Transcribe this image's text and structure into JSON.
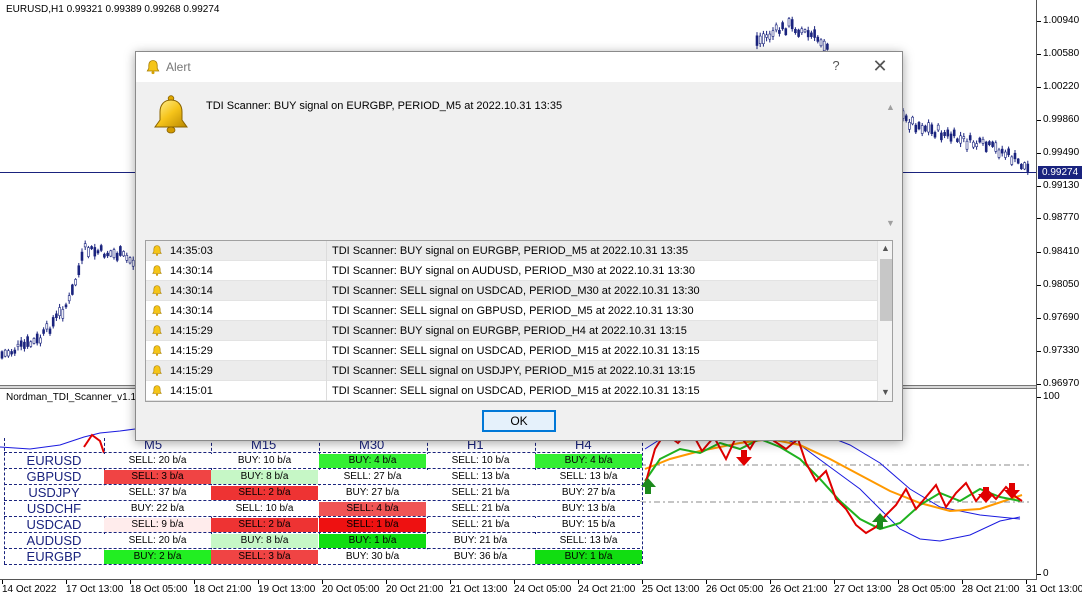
{
  "chart": {
    "symbol_line": "EURUSD,H1  0.99321 0.99389 0.99268 0.99274",
    "indicator_name": "Nordman_TDI_Scanner_v1.1",
    "current_price": "0.99274",
    "price_axis": [
      "1.00940",
      "1.00580",
      "1.00220",
      "0.99860",
      "0.99490",
      "0.99130",
      "0.98770",
      "0.98410",
      "0.98050",
      "0.97690",
      "0.97330",
      "0.96970"
    ],
    "indicator_axis": [
      "100",
      "0"
    ],
    "time_axis": [
      "14 Oct 2022",
      "17 Oct 13:00",
      "18 Oct 05:00",
      "18 Oct 21:00",
      "19 Oct 13:00",
      "20 Oct 05:00",
      "20 Oct 21:00",
      "21 Oct 13:00",
      "24 Oct 05:00",
      "24 Oct 21:00",
      "25 Oct 13:00",
      "26 Oct 05:00",
      "26 Oct 21:00",
      "27 Oct 13:00",
      "28 Oct 05:00",
      "28 Oct 21:00",
      "31 Oct 13:00"
    ],
    "colors": {
      "candle": "#1a237e",
      "price_line": "#1a237e",
      "rsi": "#e00000",
      "signal": "#1fb21f",
      "mid": "#ff9900",
      "band": "#1a1adf"
    }
  },
  "scanner": {
    "timeframes": [
      "M5",
      "M15",
      "M30",
      "H1",
      "H4"
    ],
    "rows": [
      {
        "symbol": "EURUSD",
        "cells": [
          {
            "text": "SELL: 20 b/a",
            "bg": "#ffffff"
          },
          {
            "text": "BUY: 10 b/a",
            "bg": "#ffffff"
          },
          {
            "text": "BUY: 4 b/a",
            "bg": "#33ee33"
          },
          {
            "text": "SELL: 10 b/a",
            "bg": "#ffffff"
          },
          {
            "text": "BUY: 4 b/a",
            "bg": "#33ee33"
          }
        ]
      },
      {
        "symbol": "GBPUSD",
        "cells": [
          {
            "text": "SELL: 3 b/a",
            "bg": "#f04444"
          },
          {
            "text": "BUY: 8 b/a",
            "bg": "#c6f7c6"
          },
          {
            "text": "SELL: 27 b/a",
            "bg": "#ffffff"
          },
          {
            "text": "SELL: 13 b/a",
            "bg": "#ffffff"
          },
          {
            "text": "SELL: 13 b/a",
            "bg": "#ffffff"
          }
        ]
      },
      {
        "symbol": "USDJPY",
        "cells": [
          {
            "text": "SELL: 37 b/a",
            "bg": "#ffffff"
          },
          {
            "text": "SELL: 2 b/a",
            "bg": "#ee3333"
          },
          {
            "text": "BUY: 27 b/a",
            "bg": "#ffffff"
          },
          {
            "text": "SELL: 21 b/a",
            "bg": "#ffffff"
          },
          {
            "text": "BUY: 27 b/a",
            "bg": "#ffffff"
          }
        ]
      },
      {
        "symbol": "USDCHF",
        "cells": [
          {
            "text": "BUY: 22 b/a",
            "bg": "#ffffff"
          },
          {
            "text": "SELL: 10 b/a",
            "bg": "#ffffff"
          },
          {
            "text": "SELL: 4 b/a",
            "bg": "#f05555"
          },
          {
            "text": "SELL: 21 b/a",
            "bg": "#ffffff"
          },
          {
            "text": "BUY: 13 b/a",
            "bg": "#ffffff"
          }
        ]
      },
      {
        "symbol": "USDCAD",
        "cells": [
          {
            "text": "SELL: 9 b/a",
            "bg": "#ffecec"
          },
          {
            "text": "SELL: 2 b/a",
            "bg": "#ee3333"
          },
          {
            "text": "SELL: 1 b/a",
            "bg": "#ee1111"
          },
          {
            "text": "SELL: 21 b/a",
            "bg": "#ffffff"
          },
          {
            "text": "BUY: 15 b/a",
            "bg": "#ffffff"
          }
        ]
      },
      {
        "symbol": "AUDUSD",
        "cells": [
          {
            "text": "SELL: 20 b/a",
            "bg": "#ffffff"
          },
          {
            "text": "BUY: 8 b/a",
            "bg": "#c6f7c6"
          },
          {
            "text": "BUY: 1 b/a",
            "bg": "#11dd11"
          },
          {
            "text": "BUY: 21 b/a",
            "bg": "#ffffff"
          },
          {
            "text": "SELL: 13 b/a",
            "bg": "#ffffff"
          }
        ]
      },
      {
        "symbol": "EURGBP",
        "cells": [
          {
            "text": "BUY: 2 b/a",
            "bg": "#22ee22"
          },
          {
            "text": "SELL: 3 b/a",
            "bg": "#f04444"
          },
          {
            "text": "BUY: 30 b/a",
            "bg": "#ffffff"
          },
          {
            "text": "BUY: 36 b/a",
            "bg": "#ffffff"
          },
          {
            "text": "BUY: 1 b/a",
            "bg": "#11dd11"
          }
        ]
      }
    ]
  },
  "dialog": {
    "title": "Alert",
    "help_label": "?",
    "close_label": "✕",
    "message": "TDI Scanner: BUY signal on EURGBP, PERIOD_M5 at 2022.10.31 13:35",
    "history": [
      {
        "time": "14:35:03",
        "text": "TDI Scanner: BUY signal on EURGBP, PERIOD_M5 at 2022.10.31 13:35"
      },
      {
        "time": "14:30:14",
        "text": "TDI Scanner: BUY signal on AUDUSD, PERIOD_M30 at 2022.10.31 13:30"
      },
      {
        "time": "14:30:14",
        "text": "TDI Scanner: SELL signal on USDCAD, PERIOD_M30 at 2022.10.31 13:30"
      },
      {
        "time": "14:30:14",
        "text": "TDI Scanner: SELL signal on GBPUSD, PERIOD_M5 at 2022.10.31 13:30"
      },
      {
        "time": "14:15:29",
        "text": "TDI Scanner: BUY signal on EURGBP, PERIOD_H4 at 2022.10.31 13:15"
      },
      {
        "time": "14:15:29",
        "text": "TDI Scanner: SELL signal on USDCAD, PERIOD_M15 at 2022.10.31 13:15"
      },
      {
        "time": "14:15:29",
        "text": "TDI Scanner: SELL signal on USDJPY, PERIOD_M15 at 2022.10.31 13:15"
      },
      {
        "time": "14:15:01",
        "text": "TDI Scanner: SELL signal on USDCAD, PERIOD_M15 at 2022.10.31 13:15"
      }
    ],
    "ok_label": "OK"
  }
}
